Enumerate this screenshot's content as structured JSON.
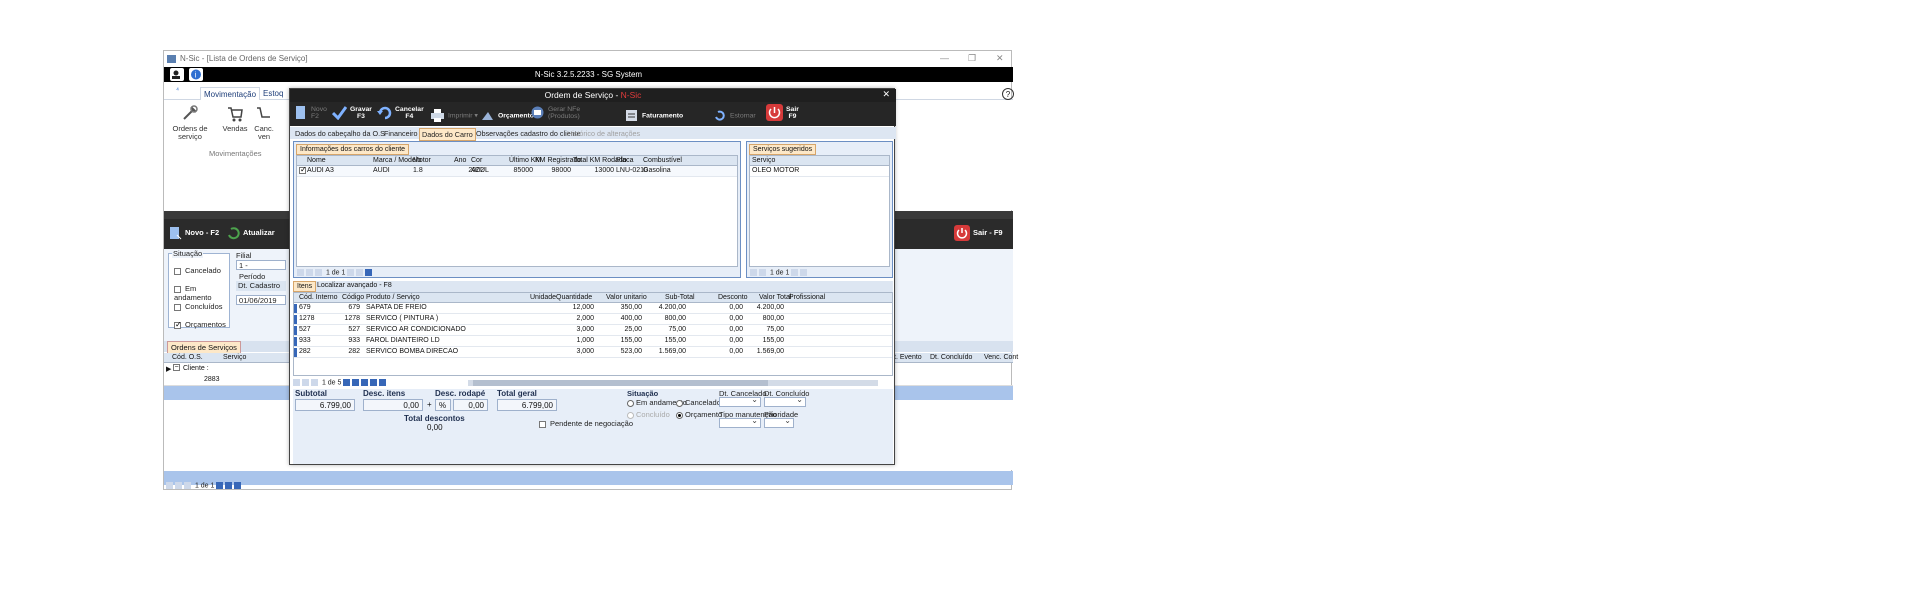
{
  "window": {
    "title": "N-Sic - [Lista de Ordens de Serviço]",
    "app_title": "N-Sic 3.2.5.2233 - SG System"
  },
  "ribbon": {
    "tabs": [
      "Movimentação",
      "Estoq"
    ],
    "buttons": [
      {
        "label": "Ordens de serviço",
        "icon": "tools-icon"
      },
      {
        "label": "Vendas",
        "icon": "cart-icon"
      },
      {
        "label": "Canc. ven",
        "icon": "cancel-cart-icon"
      }
    ],
    "group_label": "Movimentações",
    "help": "?"
  },
  "toolbar2": {
    "new_label": "Novo - F2",
    "refresh_label": "Atualizar",
    "exit_label": "Sair - F9"
  },
  "filter": {
    "situacao_title": "Situação",
    "options": [
      {
        "label": "Cancelado",
        "checked": false
      },
      {
        "label": "Em andamento",
        "checked": false
      },
      {
        "label": "Concluídos",
        "checked": false
      },
      {
        "label": "Orçamentos",
        "checked": true
      }
    ],
    "filial_label": "Filial",
    "filial_value": "1 -",
    "periodo_label": "Período",
    "dt_cadastro_label": "Dt. Cadastro",
    "date_value": "01/06/2019"
  },
  "list": {
    "tab": "Ordens de Serviços",
    "headers": [
      "Cód. O.S.",
      "Serviço",
      "Dt. Evento",
      "Dt. Concluído",
      "Venc. Cont"
    ],
    "group_label": "Cliente :",
    "row_code": "2883",
    "pager_text": "1 de 1"
  },
  "modal": {
    "title": "Ordem de Serviço - ",
    "title_app": "N-Sic",
    "toolbar": {
      "new": [
        "Novo",
        "F2"
      ],
      "save": [
        "Gravar",
        "F3"
      ],
      "cancel": [
        "Cancelar",
        "F4"
      ],
      "print": "Imprimir",
      "budget": "Orçamento",
      "nfe": [
        "Gerar NFe",
        "(Produtos)"
      ],
      "billing": "Faturamento",
      "reverse": "Estornar",
      "exit": [
        "Sair",
        "F9"
      ]
    },
    "tabs": [
      {
        "label": "Dados do cabeçalho da O.S",
        "state": "normal"
      },
      {
        "label": "Financeiro",
        "state": "normal"
      },
      {
        "label": "Dados do Carro",
        "state": "active"
      },
      {
        "label": "Observações cadastro do cliente",
        "state": "normal"
      },
      {
        "label": "Histórico de alterações",
        "state": "disabled"
      }
    ],
    "cars": {
      "panel_title": "Informações dos carros do cliente",
      "headers": [
        "Nome",
        "Marca / Modelo",
        "Motor",
        "Ano",
        "Cor",
        "Último KM",
        "KM Registrado",
        "Total KM Rodado",
        "Placa",
        "Combustível"
      ],
      "rows": [
        {
          "checked": true,
          "cells": [
            "AUDI A3",
            "AUDI",
            "1.8",
            "2002",
            "AZUL",
            "85000",
            "98000",
            "13000",
            "LNU-0210",
            "Gasolina"
          ]
        }
      ],
      "pager_text": "1 de 1"
    },
    "services": {
      "panel_title": "Serviços sugeridos",
      "header": "Serviço",
      "rows": [
        "OLEO MOTOR"
      ],
      "pager_text": "1 de 1"
    },
    "items": {
      "tabs": [
        "Itens",
        "Localizar avançado - F8"
      ],
      "headers": [
        "Cód. Interno",
        "Código",
        "Produto / Serviço",
        "Unidade",
        "Quantidade",
        "Valor unitario",
        "Sub-Total",
        "Desconto",
        "Valor Total",
        "Profissional"
      ],
      "rows": [
        [
          "679",
          "679",
          "SAPATA DE FREIO",
          "",
          "12,000",
          "350,00",
          "4.200,00",
          "0,00",
          "4.200,00",
          ""
        ],
        [
          "1278",
          "1278",
          "SERVICO ( PINTURA )",
          "",
          "2,000",
          "400,00",
          "800,00",
          "0,00",
          "800,00",
          ""
        ],
        [
          "527",
          "527",
          "SERVICO AR CONDICIONADO",
          "",
          "3,000",
          "25,00",
          "75,00",
          "0,00",
          "75,00",
          ""
        ],
        [
          "933",
          "933",
          "FAROL DIANTEIRO LD",
          "",
          "1,000",
          "155,00",
          "155,00",
          "0,00",
          "155,00",
          ""
        ],
        [
          "282",
          "282",
          "SERVICO BOMBA DIRECAO",
          "",
          "3,000",
          "523,00",
          "1.569,00",
          "0,00",
          "1.569,00",
          ""
        ]
      ],
      "pager_text": "1 de 5"
    },
    "totals": {
      "subtotal_label": "Subtotal",
      "subtotal_value": "6.799,00",
      "desc_itens_label": "Desc. itens",
      "desc_itens_value": "0,00",
      "plus": "+",
      "desc_rodape_label": "Desc. rodapé",
      "desc_rodape_pct": "%",
      "desc_rodape_value": "0,00",
      "total_geral_label": "Total geral",
      "total_geral_value": "6.799,00",
      "total_descontos_label": "Total descontos",
      "total_descontos_value": "0,00",
      "pendente_label": "Pendente de negociação"
    },
    "situacao": {
      "label": "Situação",
      "options": [
        {
          "label": "Em andamento",
          "selected": false,
          "enabled": true
        },
        {
          "label": "Cancelado",
          "selected": false,
          "enabled": true
        },
        {
          "label": "Concluído",
          "selected": false,
          "enabled": false
        },
        {
          "label": "Orçamento",
          "selected": true,
          "enabled": true
        }
      ],
      "dt_cancelado_label": "Dt. Cancelado",
      "dt_concluido_label": "Dt. Concluído",
      "tipo_manutencao_label": "Tipo manutenção",
      "prioridade_label": "Prioridade"
    }
  },
  "colors": {
    "dark_bar": "#262626",
    "accent_blue": "#3767b8",
    "active_tab": "#fde8c8",
    "exit_red": "#d63a3a"
  }
}
